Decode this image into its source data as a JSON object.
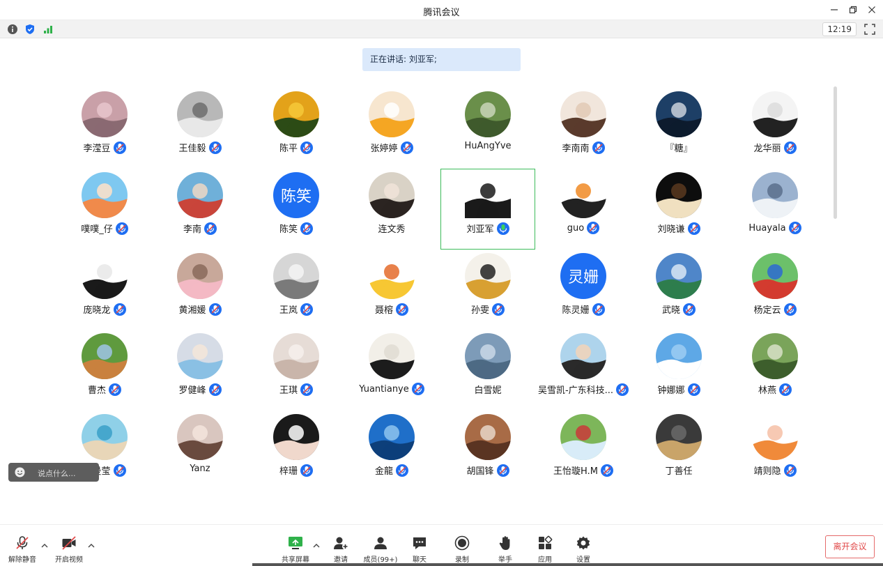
{
  "window": {
    "title": "腾讯会议"
  },
  "infobar": {
    "clock": "12:19",
    "icons": [
      "info-icon",
      "security-shield-icon",
      "signal-icon"
    ]
  },
  "speaking": {
    "text": "正在讲话: 刘亚军;"
  },
  "colors": {
    "accent": "#1e6ef2",
    "active_border": "#3cbb5a",
    "leave": "#e14a4a"
  },
  "participants": [
    {
      "name": "李滢豆",
      "mic": "muted",
      "avatar": {
        "type": "photo",
        "colors": [
          "#c9a0a8",
          "#8a6a72",
          "#e8c5cc"
        ]
      }
    },
    {
      "name": "王佳毅",
      "mic": "muted",
      "avatar": {
        "type": "photo",
        "colors": [
          "#b8b8b8",
          "#e8e8e8",
          "#6c6c6c"
        ]
      }
    },
    {
      "name": "陈平",
      "mic": "muted",
      "avatar": {
        "type": "photo",
        "colors": [
          "#e3a21a",
          "#2c4b16",
          "#f6c93a"
        ]
      }
    },
    {
      "name": "张婷婷",
      "mic": "muted",
      "avatar": {
        "type": "photo",
        "colors": [
          "#f7e6cf",
          "#f5a623",
          "#ffffff"
        ]
      }
    },
    {
      "name": "HuAngYve",
      "mic": "none",
      "avatar": {
        "type": "photo",
        "colors": [
          "#6a8f4a",
          "#3f5a2c",
          "#c9d6b8"
        ]
      }
    },
    {
      "name": "李南南",
      "mic": "muted",
      "avatar": {
        "type": "photo",
        "colors": [
          "#f1e6dc",
          "#5a3b2c",
          "#e2c9b5"
        ]
      }
    },
    {
      "name": "『糖』",
      "mic": "none",
      "avatar": {
        "type": "photo",
        "colors": [
          "#1d3f66",
          "#0d1b2e",
          "#c9d1dc"
        ]
      }
    },
    {
      "name": "龙华丽",
      "mic": "muted",
      "avatar": {
        "type": "photo",
        "colors": [
          "#f4f4f4",
          "#222222",
          "#dcdcdc"
        ]
      }
    },
    {
      "name": "噗噗_仔",
      "mic": "muted",
      "avatar": {
        "type": "photo",
        "colors": [
          "#7ec8f0",
          "#f08a4b",
          "#ffe2c8"
        ]
      }
    },
    {
      "name": "李南",
      "mic": "muted",
      "avatar": {
        "type": "photo",
        "colors": [
          "#6fb0d9",
          "#c9453a",
          "#eed8c4"
        ]
      }
    },
    {
      "name": "陈笑",
      "mic": "muted",
      "avatar": {
        "type": "text",
        "text": "陈笑",
        "colors": [
          "#1e6ef2"
        ]
      }
    },
    {
      "name": "连文秀",
      "mic": "none",
      "avatar": {
        "type": "photo",
        "colors": [
          "#d9d2c6",
          "#2b2421",
          "#f0e4d8"
        ]
      }
    },
    {
      "name": "刘亚军",
      "mic": "speaking",
      "active": true,
      "avatar": {
        "type": "photo",
        "colors": [
          "#ffffff",
          "#1a1a1a",
          "#1a1a1a"
        ]
      }
    },
    {
      "name": "guo",
      "mic": "muted",
      "avatar": {
        "type": "photo",
        "colors": [
          "#ffffff",
          "#222222",
          "#f08a24"
        ]
      }
    },
    {
      "name": "刘晓谦",
      "mic": "muted",
      "avatar": {
        "type": "photo",
        "colors": [
          "#0d0d0d",
          "#f0e0c0",
          "#5a3a20"
        ]
      }
    },
    {
      "name": "Huayala",
      "mic": "muted",
      "avatar": {
        "type": "photo",
        "colors": [
          "#9bb2cf",
          "#eef2f6",
          "#5a6f8c"
        ]
      }
    },
    {
      "name": "庞晓龙",
      "mic": "muted",
      "avatar": {
        "type": "photo",
        "colors": [
          "#ffffff",
          "#1a1a1a",
          "#e8e8e8"
        ]
      }
    },
    {
      "name": "黄湘媛",
      "mic": "muted",
      "avatar": {
        "type": "photo",
        "colors": [
          "#c8a89a",
          "#f3b9c4",
          "#8a6a5a"
        ]
      }
    },
    {
      "name": "王岚",
      "mic": "muted",
      "avatar": {
        "type": "photo",
        "colors": [
          "#d6d6d6",
          "#7a7a7a",
          "#f4f4f4"
        ]
      }
    },
    {
      "name": "聂榕",
      "mic": "muted",
      "avatar": {
        "type": "photo",
        "colors": [
          "#ffffff",
          "#f7c733",
          "#e46b2b"
        ]
      }
    },
    {
      "name": "孙雯",
      "mic": "muted",
      "avatar": {
        "type": "photo",
        "colors": [
          "#f4f1ea",
          "#d8a032",
          "#222222"
        ]
      }
    },
    {
      "name": "陈灵姗",
      "mic": "muted",
      "avatar": {
        "type": "text",
        "text": "灵姗",
        "colors": [
          "#1e6ef2"
        ]
      }
    },
    {
      "name": "武晓",
      "mic": "muted",
      "avatar": {
        "type": "photo",
        "colors": [
          "#4f86c9",
          "#2e7d4d",
          "#d8e6f4"
        ]
      }
    },
    {
      "name": "杨定云",
      "mic": "muted",
      "avatar": {
        "type": "photo",
        "colors": [
          "#6cc06a",
          "#d33b2f",
          "#2d6ad1"
        ]
      }
    },
    {
      "name": "曹杰",
      "mic": "muted",
      "avatar": {
        "type": "photo",
        "colors": [
          "#5f9a3e",
          "#c9813e",
          "#9fc4e6"
        ]
      }
    },
    {
      "name": "罗健峰",
      "mic": "muted",
      "avatar": {
        "type": "photo",
        "colors": [
          "#d6dce6",
          "#8ac0e4",
          "#f5e6d8"
        ]
      }
    },
    {
      "name": "王琪",
      "mic": "muted",
      "avatar": {
        "type": "photo",
        "colors": [
          "#e6dcd6",
          "#c9b5aa",
          "#f6f0ec"
        ]
      }
    },
    {
      "name": "Yuantianye",
      "mic": "muted",
      "avatar": {
        "type": "photo",
        "colors": [
          "#f2efe8",
          "#1c1c1c",
          "#e0dcd2"
        ]
      }
    },
    {
      "name": "白雪妮",
      "mic": "none",
      "avatar": {
        "type": "photo",
        "colors": [
          "#7d9bb8",
          "#4d6a84",
          "#c9d8e6"
        ]
      }
    },
    {
      "name": "吴雪凯-广东科技...",
      "mic": "muted",
      "avatar": {
        "type": "photo",
        "colors": [
          "#aed4ec",
          "#2a2a2a",
          "#f3d4b8"
        ]
      }
    },
    {
      "name": "钟娜娜",
      "mic": "muted",
      "avatar": {
        "type": "photo",
        "colors": [
          "#5ea8e6",
          "#ffffff",
          "#9ccdf2"
        ]
      }
    },
    {
      "name": "林燕",
      "mic": "muted",
      "avatar": {
        "type": "photo",
        "colors": [
          "#7aa45a",
          "#3d5e2c",
          "#d8e2c8"
        ]
      }
    },
    {
      "name": "罗曼莹",
      "mic": "muted",
      "avatar": {
        "type": "photo",
        "colors": [
          "#8fd0e8",
          "#e8d6b8",
          "#3aa0c8"
        ]
      }
    },
    {
      "name": "Yanz",
      "mic": "none",
      "avatar": {
        "type": "photo",
        "colors": [
          "#d9c6bf",
          "#6a4a3e",
          "#f3e4dc"
        ]
      }
    },
    {
      "name": "梓珊",
      "mic": "muted",
      "avatar": {
        "type": "photo",
        "colors": [
          "#1a1a1a",
          "#f0d8cc",
          "#ffffff"
        ]
      }
    },
    {
      "name": "金龍",
      "mic": "muted",
      "avatar": {
        "type": "photo",
        "colors": [
          "#1f6fc9",
          "#0d3f7a",
          "#8ec4ee"
        ]
      }
    },
    {
      "name": "胡国锋",
      "mic": "muted",
      "avatar": {
        "type": "photo",
        "colors": [
          "#a86b46",
          "#5a3422",
          "#e8d6c8"
        ]
      }
    },
    {
      "name": "王怡璇H.M",
      "mic": "muted",
      "avatar": {
        "type": "photo",
        "colors": [
          "#7db65a",
          "#d8ecf8",
          "#c93a3a"
        ]
      }
    },
    {
      "name": "丁善任",
      "mic": "none",
      "avatar": {
        "type": "photo",
        "colors": [
          "#3a3a3a",
          "#c9a46a",
          "#6a6a6a"
        ]
      }
    },
    {
      "name": "靖则隐",
      "mic": "muted",
      "avatar": {
        "type": "photo",
        "colors": [
          "#ffffff",
          "#f08a3a",
          "#f6c0a6"
        ]
      }
    }
  ],
  "chat": {
    "placeholder": "说点什么..."
  },
  "toolbar": {
    "unmute": "解除静音",
    "start_video": "开启视频",
    "share_screen": "共享屏幕",
    "invite": "邀请",
    "members": "成员(99+)",
    "chat": "聊天",
    "record": "录制",
    "raise_hand": "举手",
    "apps": "应用",
    "settings": "设置",
    "leave": "离开会议"
  }
}
